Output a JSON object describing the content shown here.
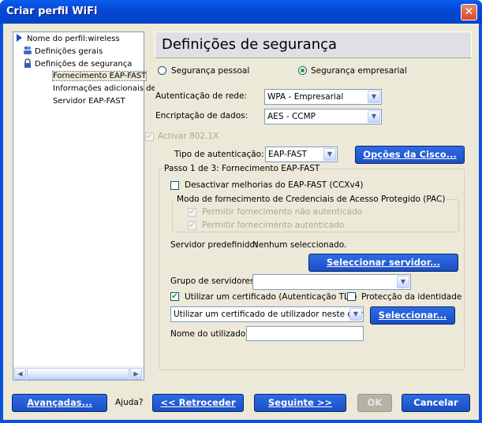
{
  "window": {
    "title": "Criar perfil WiFi",
    "close_glyph": "✕"
  },
  "tree": {
    "items": [
      {
        "label": "Nome do perfil:wireless",
        "icon": "wireless-icon"
      },
      {
        "label": "Definições gerais",
        "icon": "users-icon"
      },
      {
        "label": "Definições de segurança",
        "icon": "lock-icon"
      },
      {
        "label": "Fornecimento EAP-FAST",
        "selected": true
      },
      {
        "label": "Informações adicionais de"
      },
      {
        "label": "Servidor EAP-FAST"
      }
    ]
  },
  "panel": {
    "title": "Definições de segurança",
    "radio_personal": "Segurança pessoal",
    "radio_enterprise": "Segurança empresarial",
    "auth_label": "Autenticação de rede:",
    "auth_value": "WPA - Empresarial",
    "enc_label": "Encriptação de dados:",
    "enc_value": "AES - CCMP",
    "activate_8021x": "Activar 802.1X",
    "auth_type_label": "Tipo de autenticação:",
    "auth_type_value": "EAP-FAST",
    "cisco_button": "Opções da Cisco...",
    "step_group": "Passo 1 de 3: Fornecimento EAP-FAST",
    "disable_ccx": "Desactivar melhorias do EAP-FAST (CCXv4)",
    "pac_group": "Modo de fornecimento de Credenciais de Acesso Protegido (PAC)",
    "allow_unauth": "Permitir fornecimento não autenticado",
    "allow_auth": "Permitir fornecimento autenticado",
    "default_server_label": "Servidor predefinido:",
    "default_server_value": "Nenhum seleccionado.",
    "select_server_button": "Seleccionar servidor...",
    "server_group_label": "Grupo de servidores:",
    "server_group_value": "",
    "use_cert": "Utilizar um certificado (Autenticação TLS)",
    "identity_protection": "Protecção da identidade",
    "cert_combo_value": "Utilizar um certificado de utilizador neste computador",
    "select_button": "Seleccionar...",
    "username_label": "Nome do utilizador:",
    "username_value": ""
  },
  "footer": {
    "advanced": "Avançadas...",
    "help": "Ajuda?",
    "back": "<< Retroceder",
    "next": "Seguinte >>",
    "ok": "OK",
    "cancel": "Cancelar"
  },
  "colors": {
    "title_blue": "#0A53DC",
    "button_blue": "#1B4FC4",
    "dialog_bg": "#ECE9D8"
  }
}
